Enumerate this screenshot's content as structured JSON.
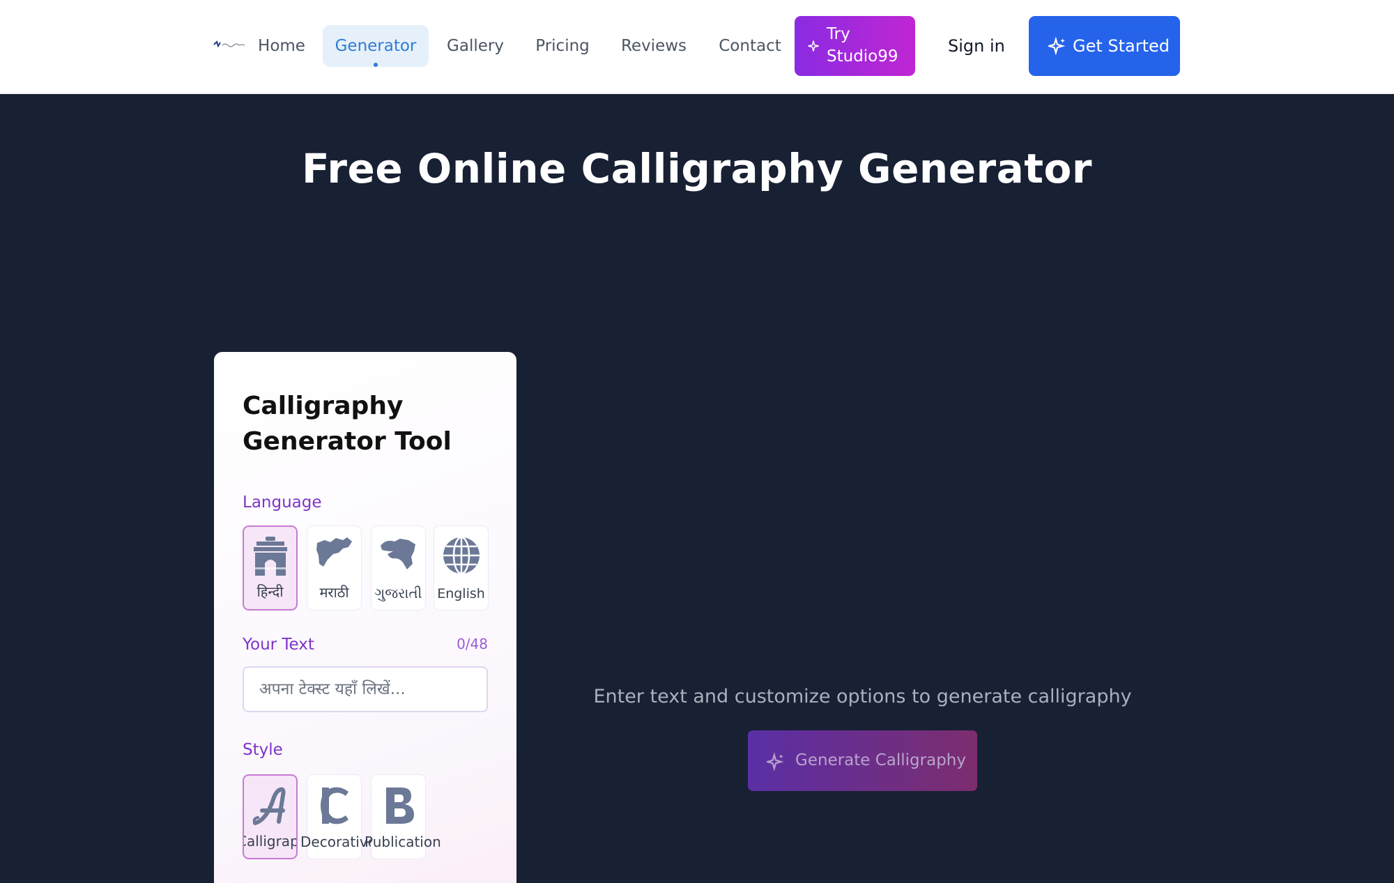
{
  "nav": {
    "links": [
      {
        "label": "Home"
      },
      {
        "label": "Generator"
      },
      {
        "label": "Gallery"
      },
      {
        "label": "Pricing"
      },
      {
        "label": "Reviews"
      },
      {
        "label": "Contact"
      }
    ],
    "active": "Generator",
    "studio_label": "Try Studio99",
    "signin_label": "Sign in",
    "start_label": "Get Started"
  },
  "hero": {
    "title": "Free Online Calligraphy Generator"
  },
  "panel": {
    "title": "Calligraphy Generator Tool",
    "language_label": "Language",
    "languages": [
      {
        "label": "हिन्दी",
        "icon": "india-gate-icon"
      },
      {
        "label": "मराठी",
        "icon": "maharashtra-map-icon"
      },
      {
        "label": "ગુજરાતી",
        "icon": "gujarat-map-icon"
      },
      {
        "label": "English",
        "icon": "globe-icon"
      }
    ],
    "selected_language": "हिन्दी",
    "text_label": "Your Text",
    "counter": "0/48",
    "text_placeholder": "अपना टेक्स्ट यहाँ लिखें...",
    "text_value": "",
    "style_label": "Style",
    "styles": [
      {
        "label": "Calligraphy",
        "icon": "script-a-icon"
      },
      {
        "label": "Decorative",
        "icon": "decorative-c-icon"
      },
      {
        "label": "Publication",
        "icon": "bold-b-icon"
      }
    ],
    "selected_style": "Calligraphy"
  },
  "preview": {
    "hint": "Enter text and customize options to generate calligraphy",
    "generate_label": "Generate Calligraphy"
  },
  "colors": {
    "background": "#182033",
    "accent_purple": "#7e34c8",
    "brand_blue": "#2563eb",
    "active_nav": "#2f7dd3"
  }
}
